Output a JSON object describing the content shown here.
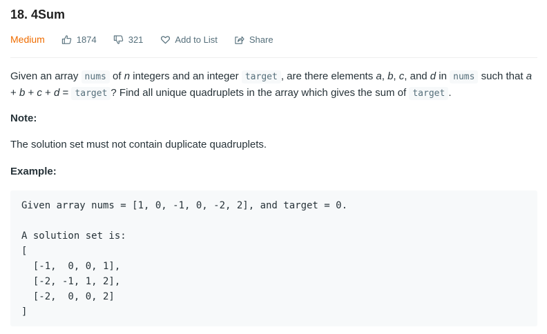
{
  "problem": {
    "title": "18. 4Sum",
    "difficulty": "Medium",
    "likes": "1874",
    "dislikes": "321",
    "add_to_list_label": "Add to List",
    "share_label": "Share"
  },
  "description": {
    "t1": "Given an array ",
    "code_nums": "nums",
    "t2": " of ",
    "var_n": "n",
    "t3": " integers and an integer ",
    "code_target": "target",
    "t4": ", are there elements ",
    "var_a": "a",
    "t5": ", ",
    "var_b": "b",
    "t6": ", ",
    "var_c": "c",
    "t7": ", and ",
    "var_d": "d",
    "t8": " in ",
    "code_nums2": "nums",
    "t9": " such that ",
    "eq_a": "a",
    "plus1": " + ",
    "eq_b": "b",
    "plus2": " + ",
    "eq_c": "c",
    "plus3": " + ",
    "eq_d": "d",
    "equals": " = ",
    "code_target2": "target",
    "t10": "? Find all unique quadruplets in the array which gives the sum of ",
    "code_target3": "target",
    "t11": "."
  },
  "note": {
    "label": "Note:",
    "text": "The solution set must not contain duplicate quadruplets."
  },
  "example": {
    "label": "Example:",
    "code": "Given array nums = [1, 0, -1, 0, -2, 2], and target = 0.\n\nA solution set is:\n[\n  [-1,  0, 0, 1],\n  [-2, -1, 1, 2],\n  [-2,  0, 0, 2]\n]"
  },
  "colors": {
    "difficulty_medium": "#ef6c00",
    "meta_text": "#546e7a",
    "code_bg": "#f7f9fa"
  },
  "icons": {
    "like": "thumbs-up-icon",
    "dislike": "thumbs-down-icon",
    "add_to_list": "heart-icon",
    "share": "share-icon"
  }
}
